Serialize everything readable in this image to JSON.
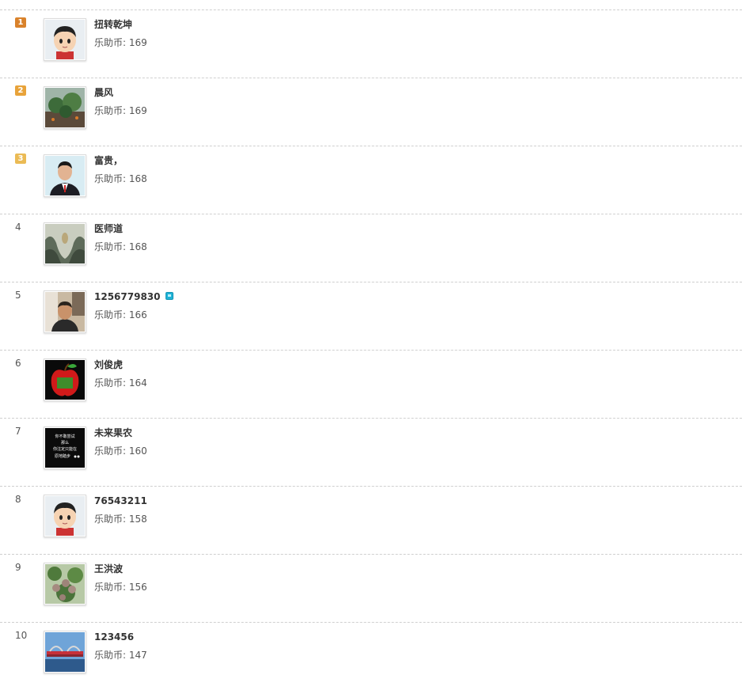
{
  "coin_label": "乐助币:",
  "users": [
    {
      "rank": "1",
      "name": "扭转乾坤",
      "coins": "169",
      "avatar": "cartoon-boy-avatar",
      "vip": false
    },
    {
      "rank": "2",
      "name": "晨风",
      "coins": "169",
      "avatar": "garden-photo-avatar",
      "vip": false
    },
    {
      "rank": "3",
      "name": "富贵，",
      "coins": "168",
      "avatar": "man-portrait-avatar",
      "vip": false
    },
    {
      "rank": "4",
      "name": "医师道",
      "coins": "168",
      "avatar": "landscape-painting-avatar",
      "vip": false
    },
    {
      "rank": "5",
      "name": "1256779830",
      "coins": "166",
      "avatar": "man-selfie-avatar",
      "vip": true
    },
    {
      "rank": "6",
      "name": "刘俊虎",
      "coins": "164",
      "avatar": "red-apple-avatar",
      "vip": false
    },
    {
      "rank": "7",
      "name": "未来果农",
      "coins": "160",
      "avatar": "black-text-avatar",
      "vip": false
    },
    {
      "rank": "8",
      "name": "76543211",
      "coins": "158",
      "avatar": "cartoon-boy-avatar",
      "vip": false
    },
    {
      "rank": "9",
      "name": "王洪波",
      "coins": "156",
      "avatar": "fruit-tree-avatar",
      "vip": false
    },
    {
      "rank": "10",
      "name": "123456",
      "coins": "147",
      "avatar": "bridge-photo-avatar",
      "vip": false
    }
  ],
  "avatar_texts": {
    "black_text_avatar": [
      "你不敢尝试",
      "那么",
      "你注定只能在",
      "原地踏步"
    ]
  }
}
